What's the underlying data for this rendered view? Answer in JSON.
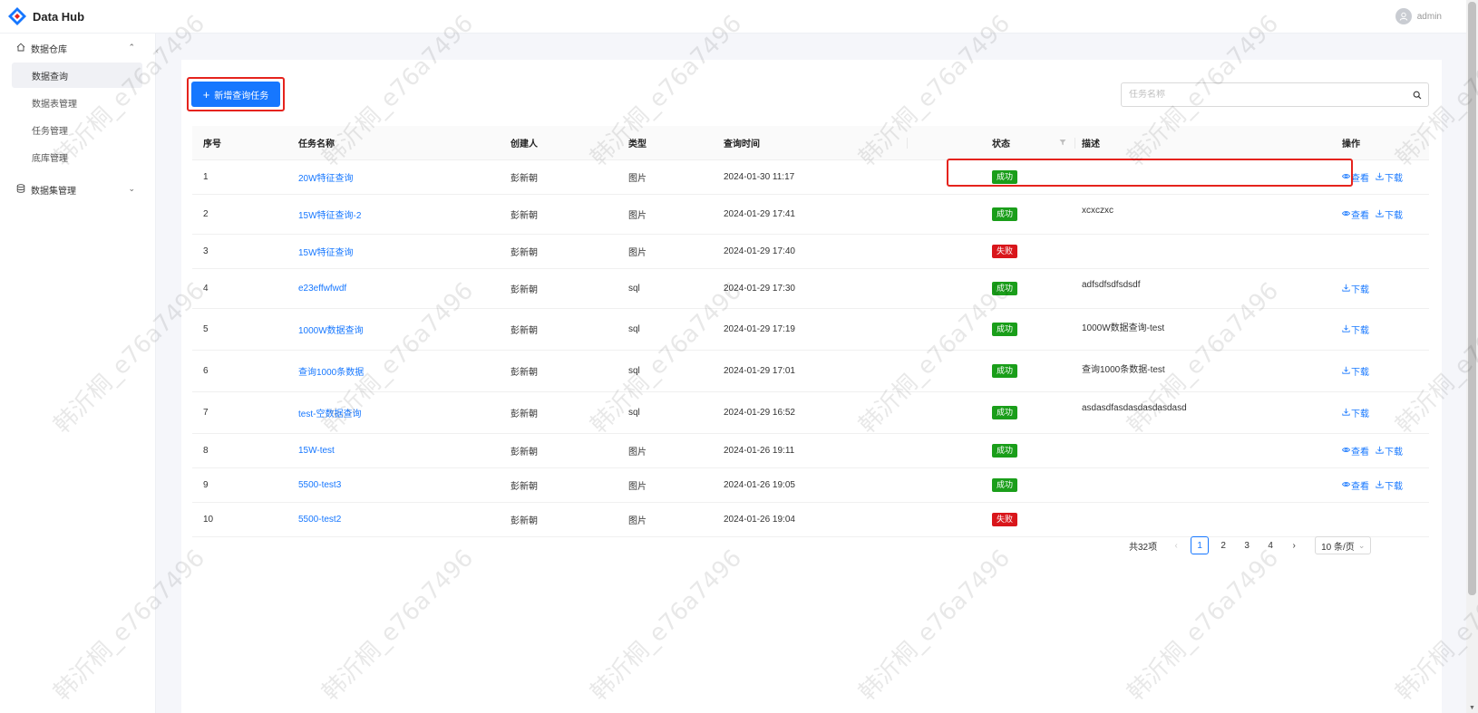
{
  "app": {
    "title": "Data Hub",
    "user": "admin",
    "accent": "#1677ff"
  },
  "sidebar": {
    "group1": {
      "label": "数据仓库",
      "icon": "home-icon",
      "expanded": true
    },
    "items": [
      {
        "label": "数据查询",
        "active": true
      },
      {
        "label": "数据表管理"
      },
      {
        "label": "任务管理"
      },
      {
        "label": "底库管理"
      }
    ],
    "group2": {
      "label": "数据集管理",
      "icon": "database-icon",
      "expanded": false
    }
  },
  "toolbar": {
    "add_label": "新增查询任务",
    "search_placeholder": "任务名称"
  },
  "table": {
    "headers": [
      "序号",
      "任务名称",
      "创建人",
      "类型",
      "查询时间",
      "状态",
      "描述",
      "操作"
    ],
    "rows": [
      {
        "no": "1",
        "name": "20W特征查询",
        "creator": "彭新朝",
        "type": "图片",
        "time": "2024-01-30 11:17",
        "status": "成功",
        "status_kind": "ok",
        "desc": "",
        "ops": [
          "查看",
          "下载"
        ]
      },
      {
        "no": "2",
        "name": "15W特征查询-2",
        "creator": "彭新朝",
        "type": "图片",
        "time": "2024-01-29 17:41",
        "status": "成功",
        "status_kind": "ok",
        "desc": "xcxczxc",
        "ops": [
          "查看",
          "下载"
        ]
      },
      {
        "no": "3",
        "name": "15W特征查询",
        "creator": "彭新朝",
        "type": "图片",
        "time": "2024-01-29 17:40",
        "status": "失败",
        "status_kind": "fail",
        "desc": "",
        "ops": []
      },
      {
        "no": "4",
        "name": "e23effwfwdf",
        "creator": "彭新朝",
        "type": "sql",
        "time": "2024-01-29 17:30",
        "status": "成功",
        "status_kind": "ok",
        "desc": "adfsdfsdfsdsdf",
        "ops": [
          "下载"
        ]
      },
      {
        "no": "5",
        "name": "1000W数据查询",
        "creator": "彭新朝",
        "type": "sql",
        "time": "2024-01-29 17:19",
        "status": "成功",
        "status_kind": "ok",
        "desc": "1000W数据查询-test",
        "ops": [
          "下载"
        ]
      },
      {
        "no": "6",
        "name": "查询1000条数据",
        "creator": "彭新朝",
        "type": "sql",
        "time": "2024-01-29 17:01",
        "status": "成功",
        "status_kind": "ok",
        "desc": "查询1000条数据-test",
        "ops": [
          "下载"
        ]
      },
      {
        "no": "7",
        "name": "test-空数据查询",
        "creator": "彭新朝",
        "type": "sql",
        "time": "2024-01-29 16:52",
        "status": "成功",
        "status_kind": "ok",
        "desc": "asdasdfasdasdasdasdasd",
        "ops": [
          "下载"
        ]
      },
      {
        "no": "8",
        "name": "15W-test",
        "creator": "彭新朝",
        "type": "图片",
        "time": "2024-01-26 19:11",
        "status": "成功",
        "status_kind": "ok",
        "desc": "",
        "ops": [
          "查看",
          "下载"
        ]
      },
      {
        "no": "9",
        "name": "5500-test3",
        "creator": "彭新朝",
        "type": "图片",
        "time": "2024-01-26 19:05",
        "status": "成功",
        "status_kind": "ok",
        "desc": "",
        "ops": [
          "查看",
          "下载"
        ]
      },
      {
        "no": "10",
        "name": "5500-test2",
        "creator": "彭新朝",
        "type": "图片",
        "time": "2024-01-26 19:04",
        "status": "失败",
        "status_kind": "fail",
        "desc": "",
        "ops": []
      }
    ]
  },
  "pagination": {
    "total": "共32项",
    "pages": [
      "1",
      "2",
      "3",
      "4"
    ],
    "current": "1",
    "page_size": "10 条/页"
  },
  "watermark": "韩沂桐_e76a7496",
  "colors": {
    "success": "#1a9e1a",
    "fail": "#d9161b",
    "highlight": "#e5231d"
  }
}
